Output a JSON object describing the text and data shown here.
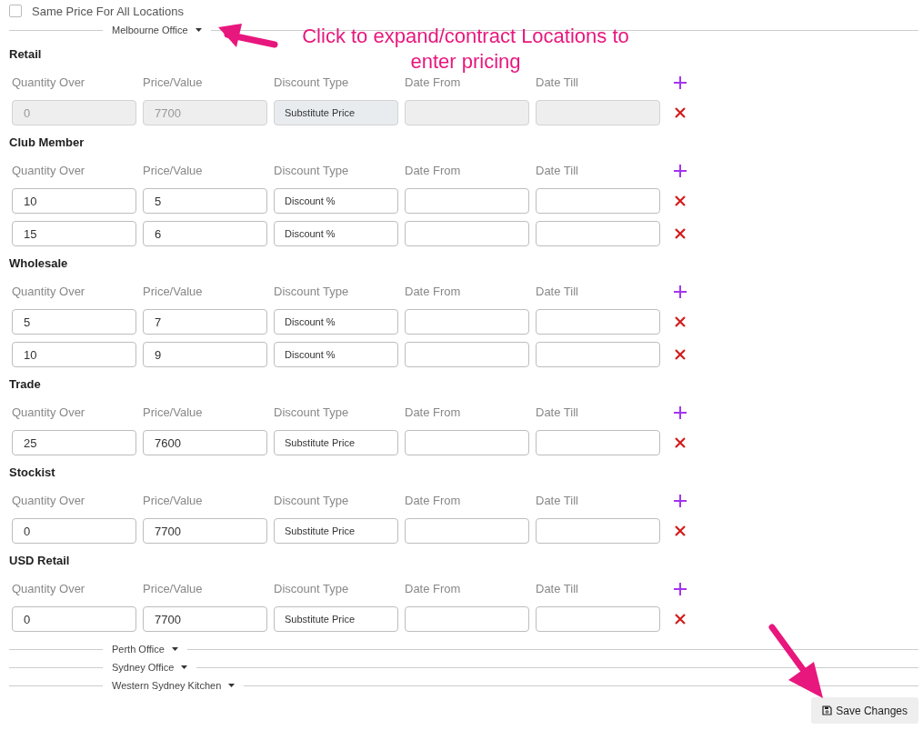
{
  "same_price": {
    "label": "Same Price For All Locations",
    "checked": false
  },
  "locations": [
    {
      "name": "Melbourne Office",
      "price_groups": [
        {
          "title": "Retail",
          "columns": [
            "Quantity Over",
            "Price/Value",
            "Discount Type",
            "Date From",
            "Date Till"
          ],
          "rows": [
            {
              "quantity_over": "0",
              "price_value": "7700",
              "discount_type": "Substitute Price",
              "disabled": true
            }
          ]
        },
        {
          "title": "Club Member",
          "columns": [
            "Quantity Over",
            "Price/Value",
            "Discount Type",
            "Date From",
            "Date Till"
          ],
          "rows": [
            {
              "quantity_over": "10",
              "price_value": "5",
              "discount_type": "Discount %",
              "disabled": false
            },
            {
              "quantity_over": "15",
              "price_value": "6",
              "discount_type": "Discount %",
              "disabled": false
            }
          ]
        },
        {
          "title": "Wholesale",
          "columns": [
            "Quantity Over",
            "Price/Value",
            "Discount Type",
            "Date From",
            "Date Till"
          ],
          "rows": [
            {
              "quantity_over": "5",
              "price_value": "7",
              "discount_type": "Discount %",
              "disabled": false
            },
            {
              "quantity_over": "10",
              "price_value": "9",
              "discount_type": "Discount %",
              "disabled": false
            }
          ]
        },
        {
          "title": "Trade",
          "columns": [
            "Quantity Over",
            "Price/Value",
            "Discount Type",
            "Date From",
            "Date Till"
          ],
          "rows": [
            {
              "quantity_over": "25",
              "price_value": "7600",
              "discount_type": "Substitute Price",
              "disabled": false
            }
          ]
        },
        {
          "title": "Stockist",
          "columns": [
            "Quantity Over",
            "Price/Value",
            "Discount Type",
            "Date From",
            "Date Till"
          ],
          "rows": [
            {
              "quantity_over": "0",
              "price_value": "7700",
              "discount_type": "Substitute Price",
              "disabled": false
            }
          ]
        },
        {
          "title": "USD Retail",
          "columns": [
            "Quantity Over",
            "Price/Value",
            "Discount Type",
            "Date From",
            "Date Till"
          ],
          "rows": [
            {
              "quantity_over": "0",
              "price_value": "7700",
              "discount_type": "Substitute Price",
              "disabled": false
            }
          ]
        }
      ]
    },
    {
      "name": "Perth Office"
    },
    {
      "name": "Sydney Office"
    },
    {
      "name": "Western Sydney Kitchen"
    }
  ],
  "annotation": {
    "text": "Click to expand/contract Locations to enter pricing"
  },
  "save_button": {
    "label": "Save Changes"
  }
}
